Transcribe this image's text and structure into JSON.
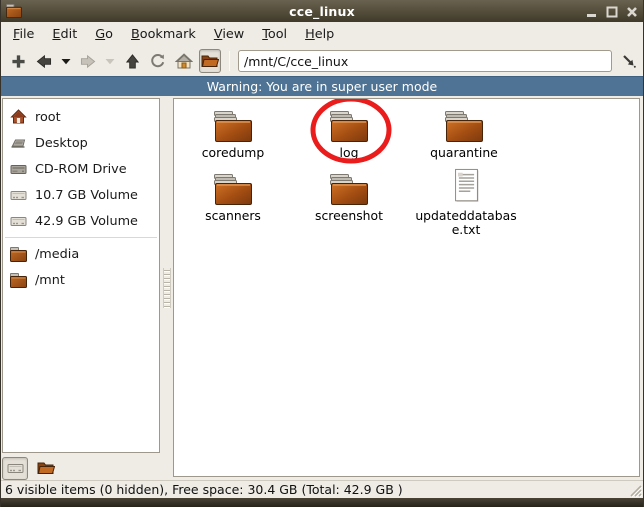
{
  "window": {
    "title": "cce_linux",
    "controls": [
      {
        "name": "minimize"
      },
      {
        "name": "maximize"
      },
      {
        "name": "close"
      }
    ]
  },
  "menu": {
    "items": [
      {
        "label": "File"
      },
      {
        "label": "Edit"
      },
      {
        "label": "Go"
      },
      {
        "label": "Bookmark"
      },
      {
        "label": "View"
      },
      {
        "label": "Tool"
      },
      {
        "label": "Help"
      }
    ]
  },
  "toolbar": {
    "buttons": [
      {
        "icon": "new-tab-plus-icon",
        "enabled": true
      },
      {
        "icon": "back-arrow-icon",
        "enabled": true
      },
      {
        "icon": "back-history-chevron-icon",
        "enabled": true
      },
      {
        "icon": "forward-arrow-icon",
        "enabled": false
      },
      {
        "icon": "forward-history-chevron-icon",
        "enabled": false
      },
      {
        "icon": "up-arrow-icon",
        "enabled": true
      },
      {
        "icon": "refresh-icon",
        "enabled": true
      },
      {
        "icon": "home-icon",
        "enabled": true
      },
      {
        "icon": "side-pane-folder-icon",
        "enabled": true,
        "pressed": true
      }
    ],
    "address_value": "/mnt/C/cce_linux",
    "jump_icon": "go-jump-icon"
  },
  "warning": {
    "text": "Warning: You are in super user mode"
  },
  "sidebar": {
    "items": [
      {
        "label": "root",
        "icon": "home-icon"
      },
      {
        "label": "Desktop",
        "icon": "desktop-icon"
      },
      {
        "label": "CD-ROM Drive",
        "icon": "cdrom-drive-icon"
      },
      {
        "label": "10.7 GB Volume",
        "icon": "volume-drive-icon"
      },
      {
        "label": "42.9 GB Volume",
        "icon": "volume-drive-icon"
      },
      {
        "label": "/media",
        "icon": "folder-icon"
      },
      {
        "label": "/mnt",
        "icon": "folder-icon"
      }
    ],
    "pane_buttons": [
      {
        "icon": "places-pane-icon",
        "pressed": true
      },
      {
        "icon": "directory-tree-icon",
        "pressed": false
      }
    ]
  },
  "files": {
    "items": [
      {
        "label": "coredump",
        "type": "folder"
      },
      {
        "label": "log",
        "type": "folder",
        "annotation": "red-circle"
      },
      {
        "label": "quarantine",
        "type": "folder"
      },
      {
        "label": "scanners",
        "type": "folder"
      },
      {
        "label": "screenshot",
        "type": "folder"
      },
      {
        "label": "updateddatabase.txt",
        "type": "text-file"
      }
    ]
  },
  "statusbar": {
    "text": "6 visible items (0 hidden), Free space: 30.4 GB (Total: 42.9 GB )"
  },
  "colors": {
    "titlebar": "#57503d",
    "chrome": "#efece6",
    "warning_bg": "#4e7394",
    "folder_orange": "#b05a1a",
    "annotation_red": "#ea1c1c"
  }
}
